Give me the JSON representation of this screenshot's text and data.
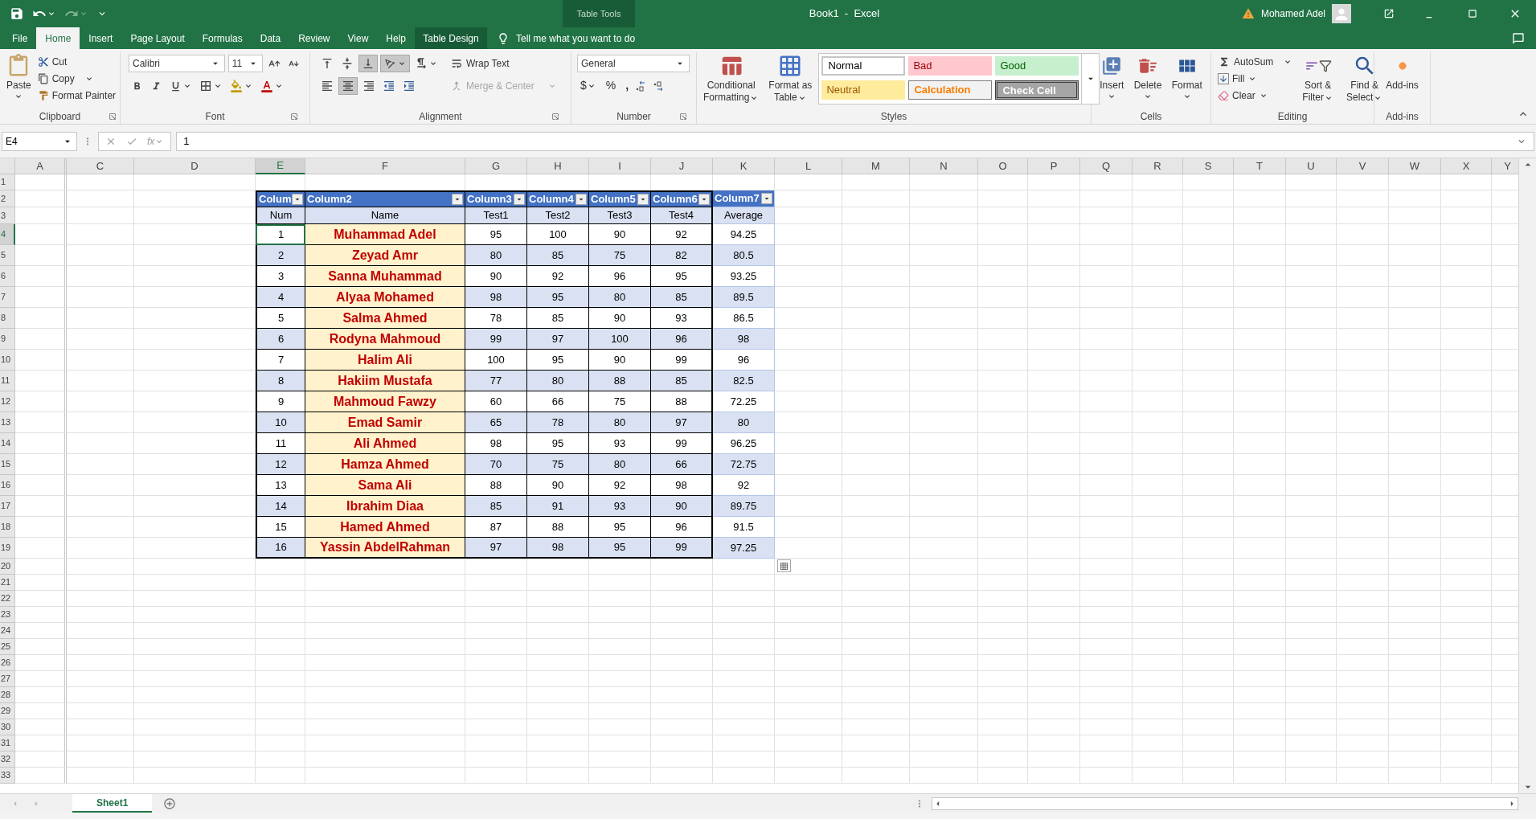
{
  "title_bar": {
    "contextual_label": "Table Tools",
    "title": "Book1  -  Excel",
    "user": "Mohamed Adel"
  },
  "tabs": [
    {
      "label": "File",
      "selected": false,
      "kind": "standard"
    },
    {
      "label": "Home",
      "selected": true,
      "kind": "standard"
    },
    {
      "label": "Insert",
      "selected": false,
      "kind": "standard"
    },
    {
      "label": "Page Layout",
      "selected": false,
      "kind": "standard"
    },
    {
      "label": "Formulas",
      "selected": false,
      "kind": "standard"
    },
    {
      "label": "Data",
      "selected": false,
      "kind": "standard"
    },
    {
      "label": "Review",
      "selected": false,
      "kind": "standard"
    },
    {
      "label": "View",
      "selected": false,
      "kind": "standard"
    },
    {
      "label": "Help",
      "selected": false,
      "kind": "standard"
    },
    {
      "label": "Table Design",
      "selected": false,
      "kind": "contextual"
    }
  ],
  "tell_me": {
    "placeholder": "Tell me what you want to do"
  },
  "ribbon": {
    "clipboard": {
      "label": "Clipboard",
      "paste": "Paste",
      "cut": "Cut",
      "copy": "Copy",
      "format_painter": "Format Painter"
    },
    "font": {
      "label": "Font",
      "font_name": "Calibri",
      "font_size": "11"
    },
    "alignment": {
      "label": "Alignment",
      "wrap_text": "Wrap Text",
      "merge_center": {
        "label": "Merge & Center",
        "disabled": true
      }
    },
    "number": {
      "label": "Number",
      "format": "General",
      "currency": "$",
      "percent": "%",
      "comma": ","
    },
    "styles": {
      "label": "Styles",
      "conditional_formatting": [
        "Conditional",
        "Formatting"
      ],
      "format_as_table": [
        "Format as",
        "Table"
      ],
      "cell_styles": [
        {
          "label": "Normal",
          "kind": "normal"
        },
        {
          "label": "Bad",
          "kind": "bad"
        },
        {
          "label": "Good",
          "kind": "good"
        },
        {
          "label": "Neutral",
          "kind": "neutral"
        },
        {
          "label": "Calculation",
          "kind": "calculation"
        },
        {
          "label": "Check Cell",
          "kind": "check"
        }
      ]
    },
    "cells": {
      "label": "Cells",
      "buttons": [
        "Insert",
        "Delete",
        "Format"
      ]
    },
    "editing": {
      "label": "Editing",
      "autosum": "AutoSum",
      "fill": "Fill",
      "clear": "Clear",
      "sort_filter": [
        "Sort &",
        "Filter"
      ],
      "find_select": [
        "Find &",
        "Select"
      ]
    },
    "add_ins": {
      "label": "Add-ins",
      "button": "Add-ins"
    }
  },
  "formula_bar": {
    "name_box": "E4",
    "function_label": "fx",
    "value": "1"
  },
  "columns": [
    {
      "label": "A",
      "selected": false
    },
    {
      "label": "C",
      "selected": false
    },
    {
      "label": "D",
      "selected": false
    },
    {
      "label": "E",
      "selected": true
    },
    {
      "label": "F",
      "selected": false
    },
    {
      "label": "G",
      "selected": false
    },
    {
      "label": "H",
      "selected": false
    },
    {
      "label": "I",
      "selected": false
    },
    {
      "label": "J",
      "selected": false
    },
    {
      "label": "K",
      "selected": false
    },
    {
      "label": "L",
      "selected": false
    },
    {
      "label": "M",
      "selected": false
    },
    {
      "label": "N",
      "selected": false
    },
    {
      "label": "O",
      "selected": false
    },
    {
      "label": "P",
      "selected": false
    },
    {
      "label": "Q",
      "selected": false
    },
    {
      "label": "R",
      "selected": false
    },
    {
      "label": "S",
      "selected": false
    },
    {
      "label": "T",
      "selected": false
    },
    {
      "label": "U",
      "selected": false
    },
    {
      "label": "V",
      "selected": false
    },
    {
      "label": "W",
      "selected": false
    },
    {
      "label": "X",
      "selected": false
    },
    {
      "label": "Y",
      "selected": false
    }
  ],
  "rows": [
    {
      "label": "1",
      "selected": false
    },
    {
      "label": "2",
      "selected": false
    },
    {
      "label": "3",
      "selected": false
    },
    {
      "label": "4",
      "selected": true
    },
    {
      "label": "5",
      "selected": false
    },
    {
      "label": "6",
      "selected": false
    },
    {
      "label": "7",
      "selected": false
    },
    {
      "label": "8",
      "selected": false
    },
    {
      "label": "9",
      "selected": false
    },
    {
      "label": "10",
      "selected": false
    },
    {
      "label": "11",
      "selected": false
    },
    {
      "label": "12",
      "selected": false
    },
    {
      "label": "13",
      "selected": false
    },
    {
      "label": "14",
      "selected": false
    },
    {
      "label": "15",
      "selected": false
    },
    {
      "label": "16",
      "selected": false
    },
    {
      "label": "17",
      "selected": false
    },
    {
      "label": "18",
      "selected": false
    },
    {
      "label": "19",
      "selected": false
    },
    {
      "label": "20",
      "selected": false
    },
    {
      "label": "21",
      "selected": false
    },
    {
      "label": "22",
      "selected": false
    },
    {
      "label": "23",
      "selected": false
    },
    {
      "label": "24",
      "selected": false
    },
    {
      "label": "25",
      "selected": false
    },
    {
      "label": "26",
      "selected": false
    },
    {
      "label": "27",
      "selected": false
    },
    {
      "label": "28",
      "selected": false
    },
    {
      "label": "29",
      "selected": false
    },
    {
      "label": "30",
      "selected": false
    },
    {
      "label": "31",
      "selected": false
    },
    {
      "label": "32",
      "selected": false
    },
    {
      "label": "33",
      "selected": false
    }
  ],
  "table": {
    "headers": [
      "Colum",
      "Column2",
      "Column3",
      "Column4",
      "Column5",
      "Column6",
      "Column7"
    ],
    "subheaders": [
      "Num",
      "Name",
      "Test1",
      "Test2",
      "Test3",
      "Test4",
      "Average"
    ],
    "rows": [
      {
        "num": "1",
        "name": "Muhammad Adel",
        "scores": [
          "95",
          "100",
          "90",
          "92"
        ],
        "average": "94.25",
        "selected": true
      },
      {
        "num": "2",
        "name": "Zeyad Amr",
        "scores": [
          "80",
          "85",
          "75",
          "82"
        ],
        "average": "80.5",
        "selected": false
      },
      {
        "num": "3",
        "name": "Sanna Muhammad",
        "scores": [
          "90",
          "92",
          "96",
          "95"
        ],
        "average": "93.25",
        "selected": false
      },
      {
        "num": "4",
        "name": "Alyaa Mohamed",
        "scores": [
          "98",
          "95",
          "80",
          "85"
        ],
        "average": "89.5",
        "selected": false
      },
      {
        "num": "5",
        "name": "Salma Ahmed",
        "scores": [
          "78",
          "85",
          "90",
          "93"
        ],
        "average": "86.5",
        "selected": false
      },
      {
        "num": "6",
        "name": "Rodyna Mahmoud",
        "scores": [
          "99",
          "97",
          "100",
          "96"
        ],
        "average": "98",
        "selected": false
      },
      {
        "num": "7",
        "name": "Halim Ali",
        "scores": [
          "100",
          "95",
          "90",
          "99"
        ],
        "average": "96",
        "selected": false
      },
      {
        "num": "8",
        "name": "Hakiim Mustafa",
        "scores": [
          "77",
          "80",
          "88",
          "85"
        ],
        "average": "82.5",
        "selected": false
      },
      {
        "num": "9",
        "name": "Mahmoud Fawzy",
        "scores": [
          "60",
          "66",
          "75",
          "88"
        ],
        "average": "72.25",
        "selected": false
      },
      {
        "num": "10",
        "name": "Emad Samir",
        "scores": [
          "65",
          "78",
          "80",
          "97"
        ],
        "average": "80",
        "selected": false
      },
      {
        "num": "11",
        "name": "Ali Ahmed",
        "scores": [
          "98",
          "95",
          "93",
          "99"
        ],
        "average": "96.25",
        "selected": false
      },
      {
        "num": "12",
        "name": "Hamza Ahmed",
        "scores": [
          "70",
          "75",
          "80",
          "66"
        ],
        "average": "72.75",
        "selected": false
      },
      {
        "num": "13",
        "name": "Sama Ali",
        "scores": [
          "88",
          "90",
          "92",
          "98"
        ],
        "average": "92",
        "selected": false
      },
      {
        "num": "14",
        "name": "Ibrahim Diaa",
        "scores": [
          "85",
          "91",
          "93",
          "90"
        ],
        "average": "89.75",
        "selected": false
      },
      {
        "num": "15",
        "name": "Hamed Ahmed",
        "scores": [
          "87",
          "88",
          "95",
          "96"
        ],
        "average": "91.5",
        "selected": false
      },
      {
        "num": "16",
        "name": "Yassin AbdelRahman",
        "scores": [
          "97",
          "98",
          "95",
          "99"
        ],
        "average": "97.25",
        "selected": false
      }
    ]
  },
  "sheet_tabs": [
    {
      "label": "Sheet1",
      "selected": true
    }
  ]
}
